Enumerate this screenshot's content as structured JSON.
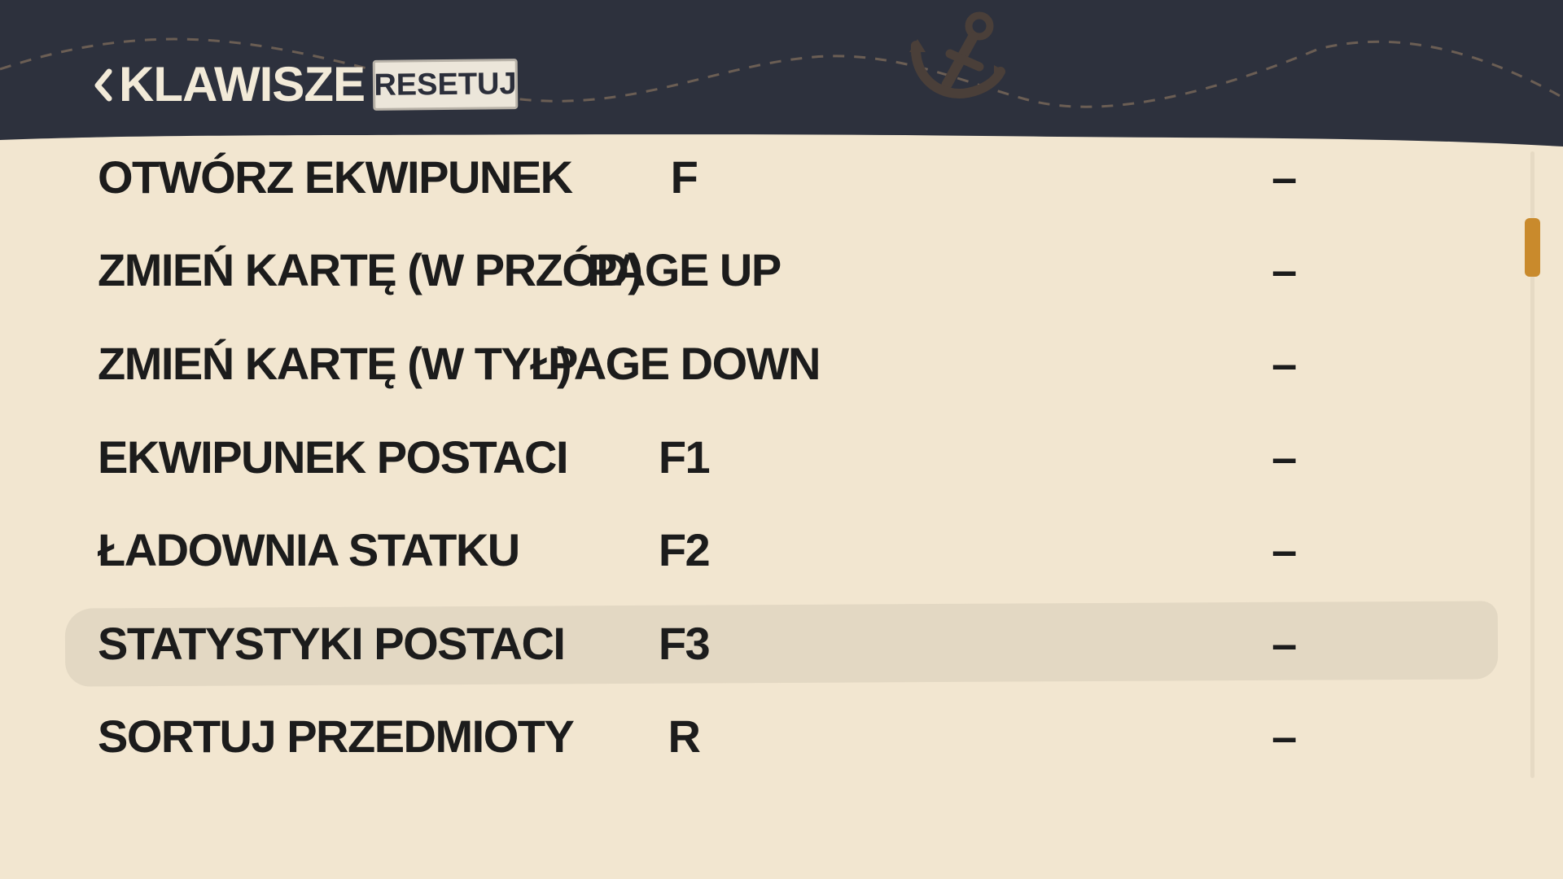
{
  "header": {
    "title": "KLAWISZE",
    "reset_label": "RESETUJ"
  },
  "icons": {
    "back": "chevron-left-icon",
    "anchor": "anchor-icon"
  },
  "colors": {
    "header_background": "#2d313d",
    "page_background": "#f2e6d0",
    "selected_row": "#e3d8c3",
    "scrollbar_thumb": "#c98a2c",
    "anchor": "#4a3f39"
  },
  "bindings": [
    {
      "action": "OTWÓRZ EKWIPUNEK",
      "primary": "F",
      "secondary": "–"
    },
    {
      "action": "ZMIEŃ KARTĘ (W PRZÓD)",
      "primary": "PAGE UP",
      "secondary": "–"
    },
    {
      "action": "ZMIEŃ KARTĘ (W TYŁ)",
      "primary": "PAGE DOWN",
      "secondary": "–"
    },
    {
      "action": "EKWIPUNEK POSTACI",
      "primary": "F1",
      "secondary": "–"
    },
    {
      "action": "ŁADOWNIA STATKU",
      "primary": "F2",
      "secondary": "–"
    },
    {
      "action": "STATYSTYKI POSTACI",
      "primary": "F3",
      "secondary": "–",
      "selected": true
    },
    {
      "action": "SORTUJ PRZEDMIOTY",
      "primary": "R",
      "secondary": "–"
    }
  ],
  "scroll_position": 0.1
}
